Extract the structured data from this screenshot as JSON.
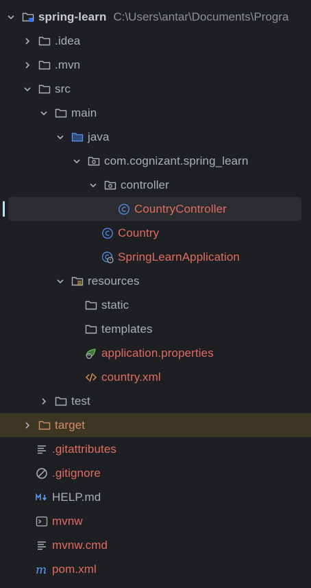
{
  "root": {
    "label": "spring-learn",
    "path": "C:\\Users\\antar\\Documents\\Progra"
  },
  "items": {
    "idea": ".idea",
    "mvn": ".mvn",
    "src": "src",
    "main": "main",
    "java": "java",
    "package": "com.cognizant.spring_learn",
    "controller": "controller",
    "country_controller": "CountryController",
    "country": "Country",
    "app": "SpringLearnApplication",
    "resources": "resources",
    "static": "static",
    "templates": "templates",
    "app_props": "application.properties",
    "country_xml": "country.xml",
    "test": "test",
    "target": "target",
    "gitattributes": ".gitattributes",
    "gitignore": ".gitignore",
    "help": "HELP.md",
    "mvnw": "mvnw",
    "mvnw_cmd": "mvnw.cmd",
    "pom": "pom.xml"
  },
  "icons": {
    "folder": "folder-icon",
    "module": "module-folder-icon",
    "source_root": "source-root-icon",
    "package": "package-icon",
    "resources_root": "resources-root-icon",
    "class": "class-icon",
    "spring_boot": "spring-boot-app-icon",
    "spring_props": "spring-properties-icon",
    "xml": "xml-icon",
    "text": "text-file-icon",
    "ignore": "ignore-file-icon",
    "markdown": "markdown-icon",
    "terminal": "shell-script-icon",
    "maven": "maven-icon"
  },
  "colors": {
    "background": "#1e1f22",
    "selection": "#2b2d30",
    "excluded": "#3d3623",
    "modified_red": "#e06c63",
    "class_blue": "#4e8be6"
  }
}
